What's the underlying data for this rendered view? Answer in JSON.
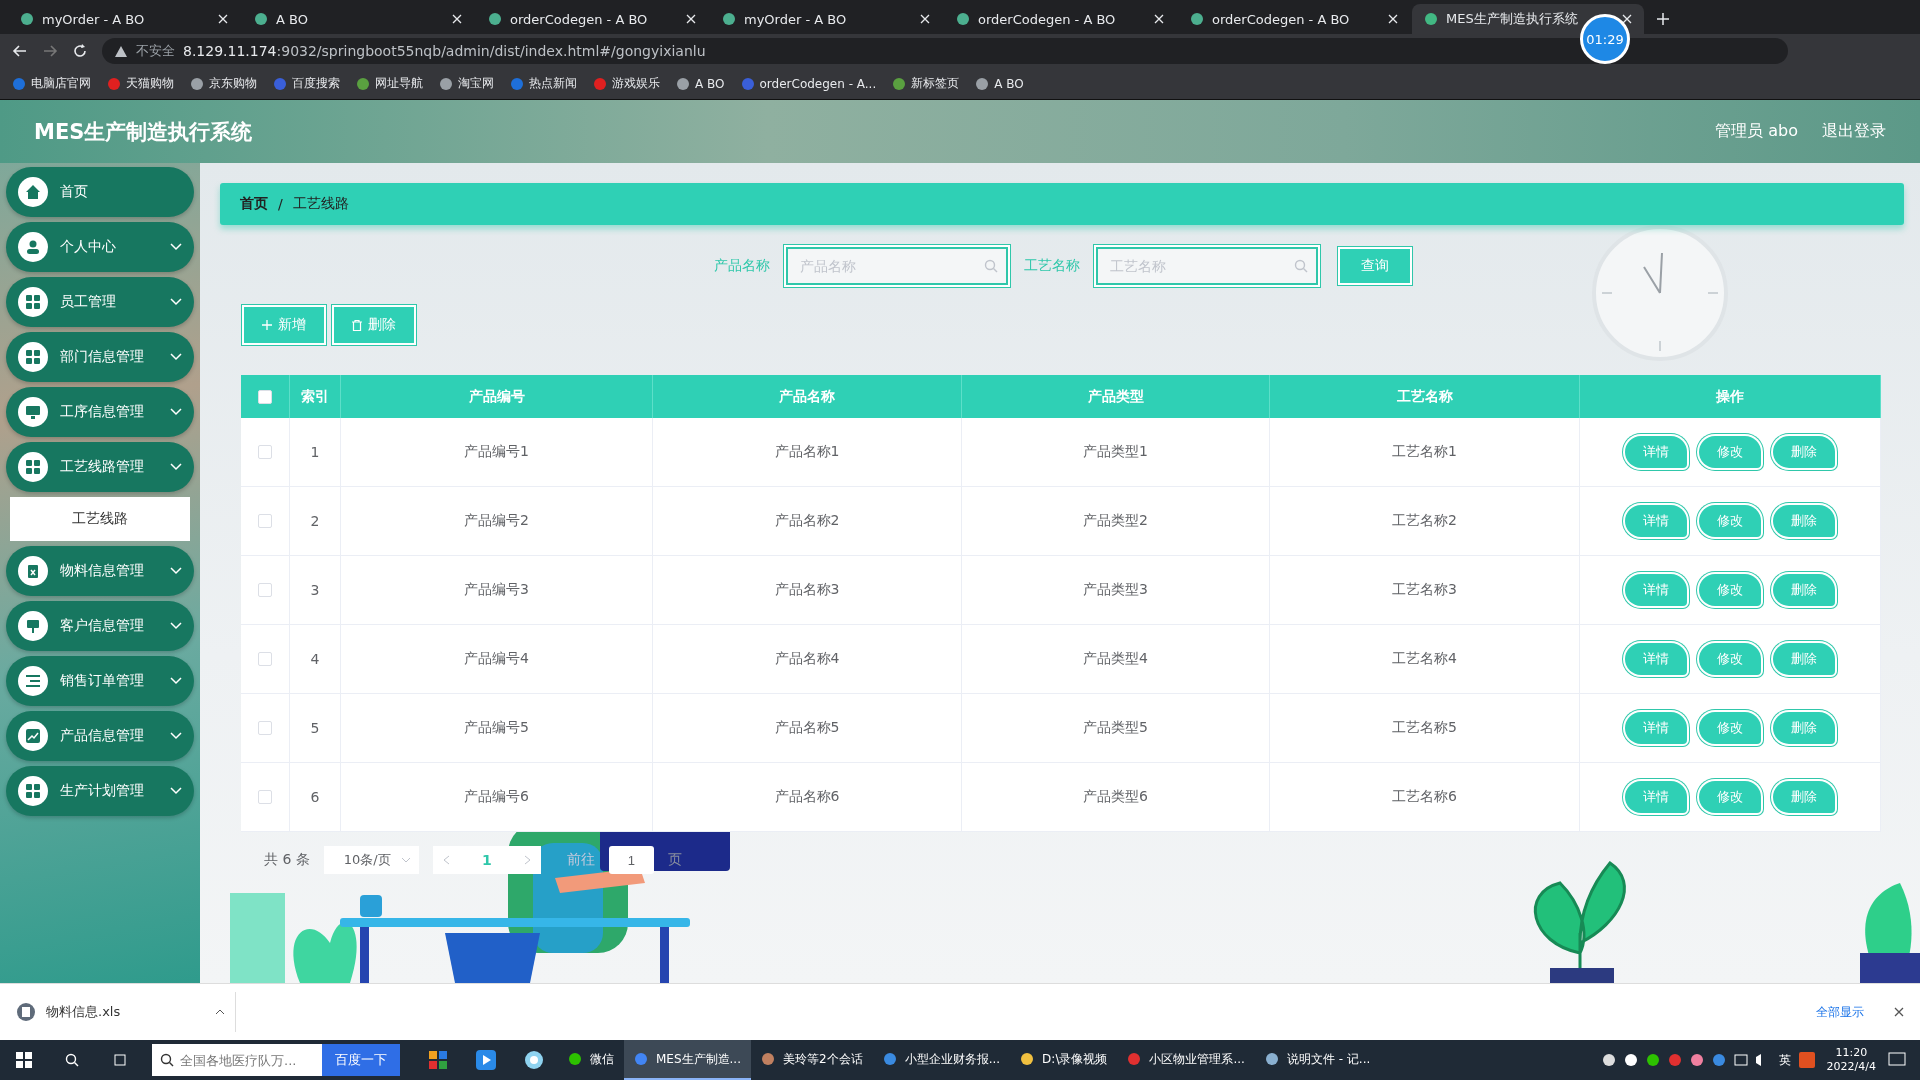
{
  "browser": {
    "tabs": [
      {
        "title": "myOrder - A BO",
        "selected": false
      },
      {
        "title": "A BO",
        "selected": false
      },
      {
        "title": "orderCodegen - A BO",
        "selected": false
      },
      {
        "title": "myOrder - A BO",
        "selected": false
      },
      {
        "title": "orderCodegen - A BO",
        "selected": false
      },
      {
        "title": "orderCodegen - A BO",
        "selected": false
      },
      {
        "title": "MES生产制造执行系统",
        "selected": true
      }
    ],
    "address": {
      "warning": "不安全",
      "host": "8.129.11.174",
      "path": ":9032/springboot55nqb/admin/dist/index.html#/gongyixianlu"
    },
    "bookmarks": [
      "电脑店官网",
      "天猫购物",
      "京东购物",
      "百度搜索",
      "网址导航",
      "淘宝网",
      "热点新闻",
      "游戏娱乐",
      "A BO",
      "orderCodegen - A...",
      "新标签页",
      "A BO"
    ],
    "timer": "01:29"
  },
  "app": {
    "title": "MES生产制造执行系统",
    "user": "管理员 abo",
    "logout": "退出登录"
  },
  "sidebar": {
    "items": [
      {
        "label": "首页",
        "kind": "link"
      },
      {
        "label": "个人中心",
        "kind": "submenu"
      },
      {
        "label": "员工管理",
        "kind": "submenu"
      },
      {
        "label": "部门信息管理",
        "kind": "submenu"
      },
      {
        "label": "工序信息管理",
        "kind": "submenu"
      },
      {
        "label": "工艺线路管理",
        "kind": "submenu",
        "children": [
          {
            "label": "工艺线路",
            "selected": true
          }
        ]
      },
      {
        "label": "物料信息管理",
        "kind": "submenu"
      },
      {
        "label": "客户信息管理",
        "kind": "submenu"
      },
      {
        "label": "销售订单管理",
        "kind": "submenu"
      },
      {
        "label": "产品信息管理",
        "kind": "submenu"
      },
      {
        "label": "生产计划管理",
        "kind": "submenu"
      }
    ]
  },
  "breadcrumb": {
    "separator": "/",
    "items": [
      "首页",
      "工艺线路"
    ]
  },
  "search": {
    "fields": [
      {
        "label": "产品名称",
        "placeholder": "产品名称"
      },
      {
        "label": "工艺名称",
        "placeholder": "工艺名称"
      }
    ],
    "button": "查询"
  },
  "actions": [
    {
      "kind": "add",
      "label": "新增"
    },
    {
      "kind": "delete",
      "label": "删除"
    }
  ],
  "table": {
    "all_checked": false,
    "columns": [
      "索引",
      "产品编号",
      "产品名称",
      "产品类型",
      "工艺名称",
      "操作"
    ],
    "rows": [
      {
        "checked": false,
        "cells": [
          "1",
          "产品编号1",
          "产品名称1",
          "产品类型1",
          "工艺名称1"
        ],
        "actions": [
          "详情",
          "修改",
          "删除"
        ]
      },
      {
        "checked": false,
        "cells": [
          "2",
          "产品编号2",
          "产品名称2",
          "产品类型2",
          "工艺名称2"
        ],
        "actions": [
          "详情",
          "修改",
          "删除"
        ]
      },
      {
        "checked": false,
        "cells": [
          "3",
          "产品编号3",
          "产品名称3",
          "产品类型3",
          "工艺名称3"
        ],
        "actions": [
          "详情",
          "修改",
          "删除"
        ]
      },
      {
        "checked": false,
        "cells": [
          "4",
          "产品编号4",
          "产品名称4",
          "产品类型4",
          "工艺名称4"
        ],
        "actions": [
          "详情",
          "修改",
          "删除"
        ]
      },
      {
        "checked": false,
        "cells": [
          "5",
          "产品编号5",
          "产品名称5",
          "产品类型5",
          "工艺名称5"
        ],
        "actions": [
          "详情",
          "修改",
          "删除"
        ]
      },
      {
        "checked": false,
        "cells": [
          "6",
          "产品编号6",
          "产品名称6",
          "产品类型6",
          "工艺名称6"
        ],
        "actions": [
          "详情",
          "修改",
          "删除"
        ]
      }
    ]
  },
  "pagination": {
    "total": "共 6 条",
    "page_size": "10条/页",
    "current": "1",
    "goto_label": "前往",
    "goto_value": "1",
    "goto_suffix": "页"
  },
  "download_bar": {
    "file": "物料信息.xls",
    "show_all": "全部显示"
  },
  "taskbar": {
    "search_placeholder": "全国各地医疗队万...",
    "search_button": "百度一下",
    "apps": [
      {
        "label": "微信",
        "active": false
      },
      {
        "label": "MES生产制造...",
        "active": true
      },
      {
        "label": "美玲等2个会话",
        "active": false
      },
      {
        "label": "小型企业财务报...",
        "active": false
      },
      {
        "label": "D:\\录像视频",
        "active": false
      },
      {
        "label": "小区物业管理系...",
        "active": false
      },
      {
        "label": "说明文件 - 记...",
        "active": false
      }
    ],
    "ime": "英",
    "time": "11:20",
    "date": "2022/4/4"
  }
}
